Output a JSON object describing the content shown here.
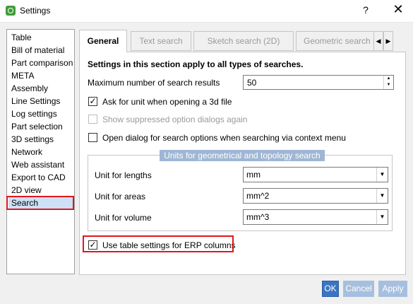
{
  "window": {
    "title": "Settings",
    "help": "?",
    "close": "✕"
  },
  "sidebar": {
    "items": [
      {
        "label": "Table"
      },
      {
        "label": "Bill of material"
      },
      {
        "label": "Part comparison"
      },
      {
        "label": "META"
      },
      {
        "label": "Assembly"
      },
      {
        "label": "Line Settings"
      },
      {
        "label": "Log settings"
      },
      {
        "label": "Part selection"
      },
      {
        "label": "3D settings"
      },
      {
        "label": "Network"
      },
      {
        "label": "Web assistant"
      },
      {
        "label": "Export to CAD"
      },
      {
        "label": "2D view"
      },
      {
        "label": "Search"
      }
    ],
    "selected": "Search"
  },
  "tabs": [
    {
      "label": "General"
    },
    {
      "label": "Text search"
    },
    {
      "label": "Sketch search (2D)"
    },
    {
      "label": "Geometric search ("
    }
  ],
  "tab_scroll": {
    "left": "◀",
    "right": "▶"
  },
  "general": {
    "heading": "Settings in this section apply to all types of searches.",
    "max_results_label": "Maximum number of search results",
    "max_results_value": "50",
    "ask_unit_label": "Ask for unit when opening a 3d file",
    "ask_unit_checked": true,
    "show_suppressed_label": "Show suppressed option dialogs again",
    "show_suppressed_checked": false,
    "open_dialog_label": "Open dialog for search options when searching via context menu",
    "open_dialog_checked": false,
    "units_group": {
      "title": "Units for geometrical and topology search",
      "lengths_label": "Unit for lengths",
      "lengths_value": "mm",
      "areas_label": "Unit for areas",
      "areas_value": "mm^2",
      "volume_label": "Unit for volume",
      "volume_value": "mm^3"
    },
    "erp_label": "Use table settings for ERP columns",
    "erp_checked": true
  },
  "buttons": {
    "ok": "OK",
    "cancel": "Cancel",
    "apply": "Apply"
  },
  "check_glyph": "✓",
  "colors": {
    "highlight": "#e0171d",
    "selection": "#cde0f5",
    "primary_button": "#3b74c2"
  }
}
